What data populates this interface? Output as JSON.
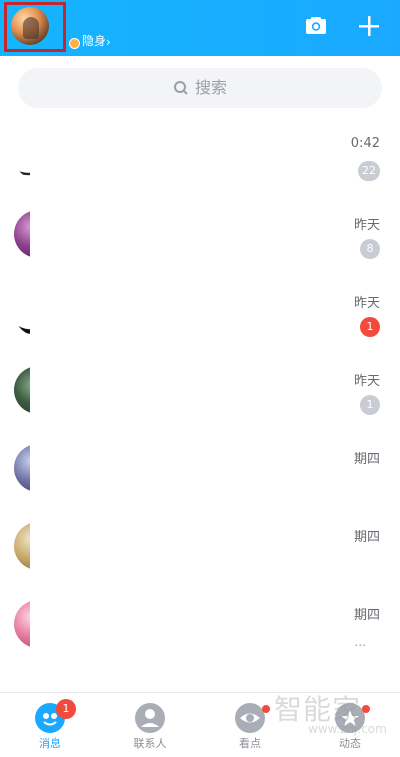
{
  "header": {
    "status_text": "隐身",
    "colors": {
      "brand": "#15b4ff"
    }
  },
  "search": {
    "label": "搜索"
  },
  "chats": [
    {
      "time": "0:42",
      "badge": "22",
      "badge_type": "gray"
    },
    {
      "time": "昨天",
      "badge": "8",
      "badge_type": "gray"
    },
    {
      "time": "昨天",
      "badge": "1",
      "badge_type": "red"
    },
    {
      "time": "昨天",
      "badge": "1",
      "badge_type": "gray"
    },
    {
      "time": "期四",
      "badge": "",
      "badge_type": ""
    },
    {
      "time": "期四",
      "badge": "",
      "badge_type": ""
    },
    {
      "time": "期四",
      "badge": "",
      "badge_type": "",
      "extra": "..."
    }
  ],
  "nav": {
    "messages": {
      "label": "消息",
      "badge": "1"
    },
    "contacts": {
      "label": "联系人"
    },
    "watch": {
      "label": "看点"
    },
    "moments": {
      "label": "动态"
    }
  },
  "watermark": {
    "title": "智能家",
    "url": "www.znj.com"
  }
}
